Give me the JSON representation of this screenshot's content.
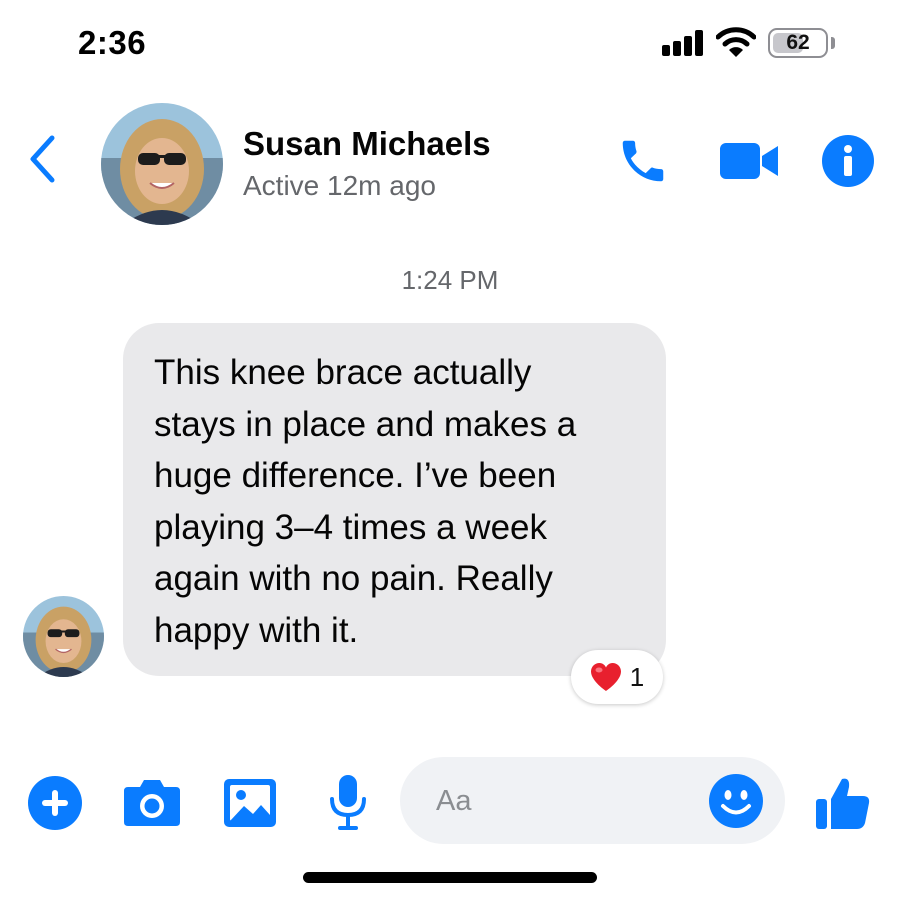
{
  "status_bar": {
    "time": "2:36",
    "battery_level": "62",
    "battery_fraction": 0.62
  },
  "header": {
    "contact_name": "Susan Michaels",
    "active_status": "Active 12m ago",
    "icons": {
      "back": "chevron-left-icon",
      "call": "phone-icon",
      "video": "video-camera-icon",
      "info": "info-icon"
    }
  },
  "conversation": {
    "timestamp": "1:24 PM",
    "messages": [
      {
        "lines": [
          "This knee brace actually",
          "stays in place and makes a",
          "huge difference. I’ve been",
          "playing 3–4 times a week",
          "again with no pain. Really",
          "happy with it."
        ],
        "reaction": {
          "emoji": "❤️",
          "count": "1"
        }
      }
    ]
  },
  "composer": {
    "placeholder": "Aa",
    "icons": [
      "plus-icon",
      "camera-icon",
      "image-icon",
      "microphone-icon",
      "emoji-icon",
      "thumbs-up-icon"
    ]
  },
  "colors": {
    "accent": "#0a7cff",
    "bubble": "#e9e9eb",
    "secondary_text": "#65676b",
    "input_bg": "#f0f2f5"
  }
}
